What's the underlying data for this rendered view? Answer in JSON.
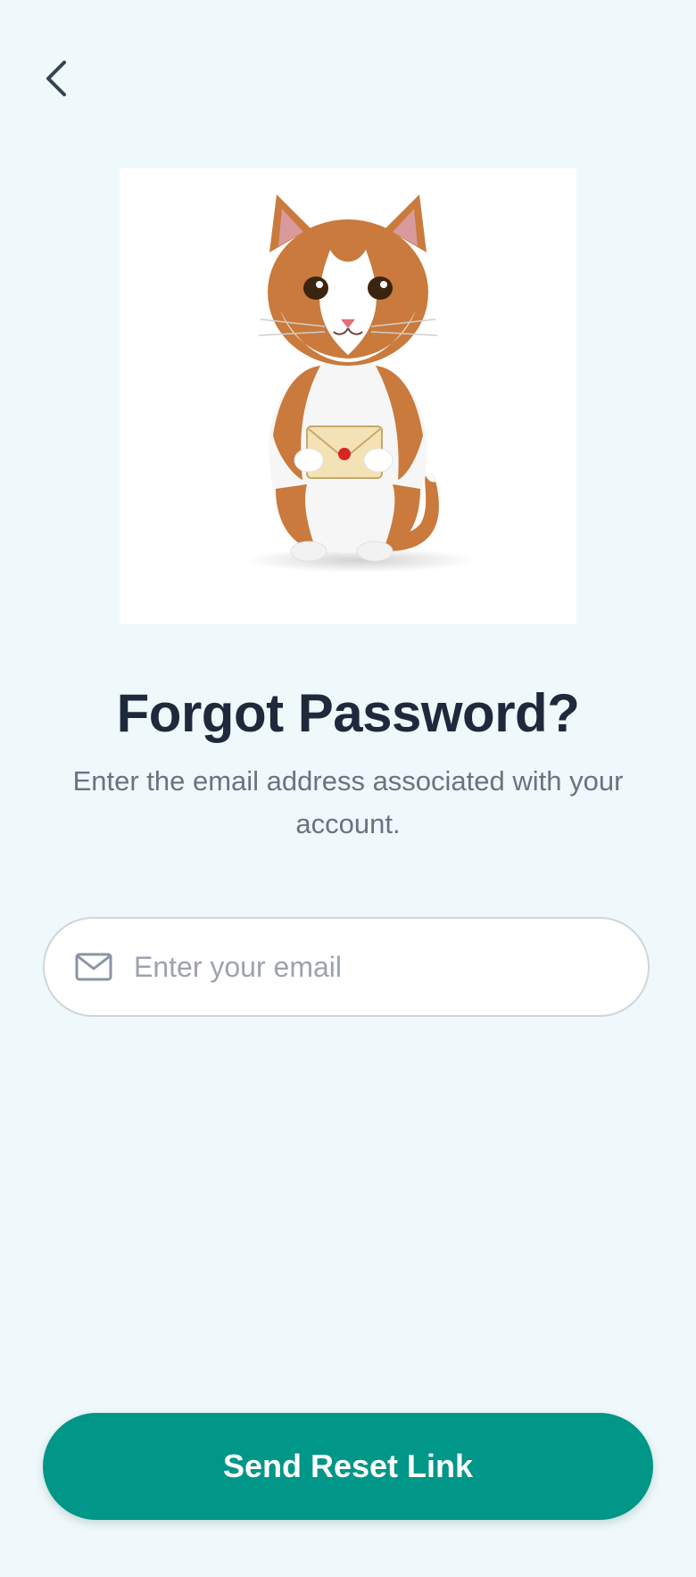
{
  "header": {
    "back_icon": "chevron-left-icon"
  },
  "illustration": {
    "subject": "cat-holding-envelope"
  },
  "main": {
    "title": "Forgot Password?",
    "subtitle": "Enter the email address associated with your account."
  },
  "form": {
    "email_placeholder": "Enter your email",
    "email_value": "",
    "email_icon": "mail-icon"
  },
  "actions": {
    "send_label": "Send Reset Link"
  },
  "colors": {
    "background": "#eff8fa",
    "primary": "#009688",
    "title": "#1e293b",
    "muted": "#6b7280",
    "placeholder": "#9ca3af"
  }
}
